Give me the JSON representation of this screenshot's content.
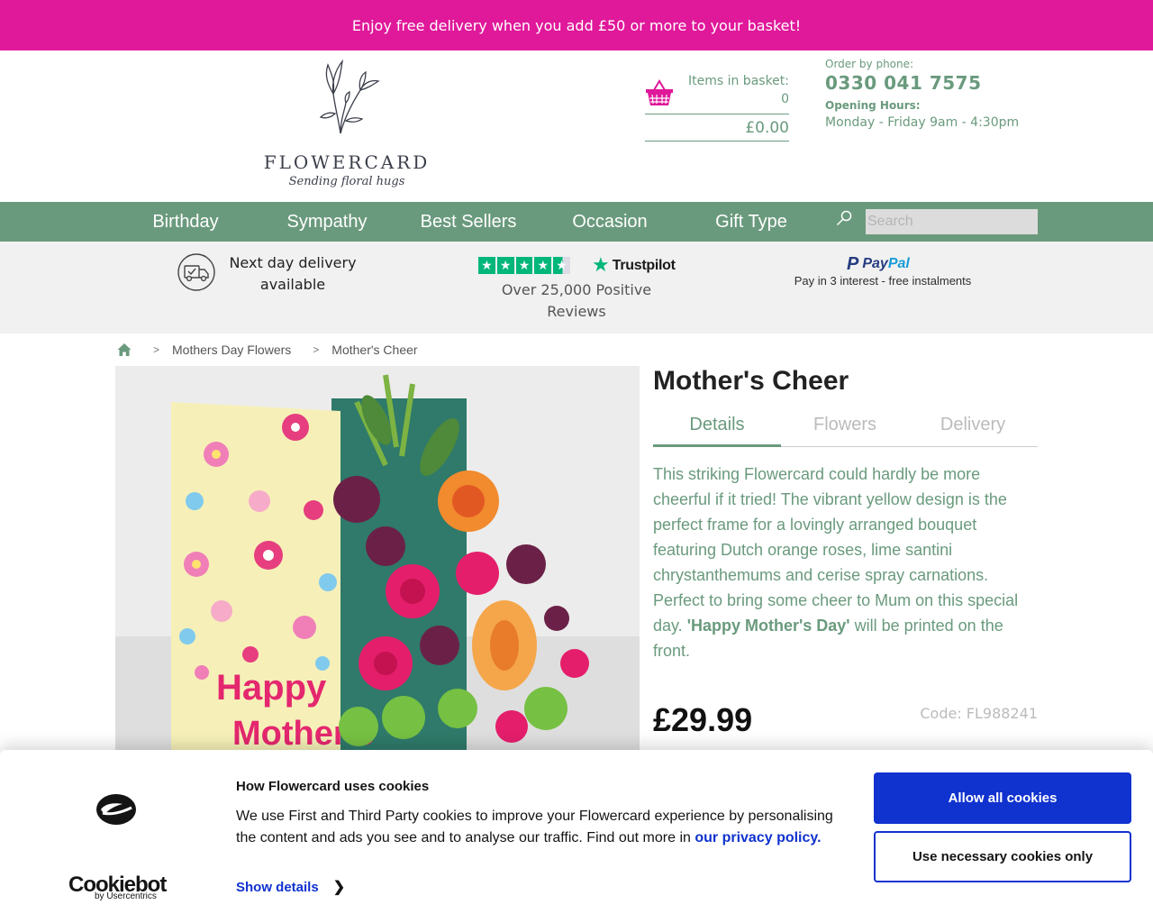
{
  "promo": {
    "text": "Enjoy free delivery when you add £50 or more to your basket!"
  },
  "brand": {
    "name": "FLOWERCARD",
    "tagline": "Sending floral hugs"
  },
  "basket": {
    "label": "Items in basket:",
    "count": "0",
    "total": "£0.00"
  },
  "contact": {
    "order_label": "Order by phone:",
    "phone": "0330 041 7575",
    "hours_label": "Opening Hours:",
    "hours": "Monday - Friday 9am - 4:30pm"
  },
  "nav": {
    "items": [
      "Birthday",
      "Sympathy",
      "Best Sellers",
      "Occasion",
      "Gift Type"
    ],
    "search_placeholder": "Search"
  },
  "usp": {
    "delivery": "Next day delivery available",
    "trustpilot_brand": "Trustpilot",
    "trustpilot_text": "Over 25,000 Positive Reviews",
    "trustpilot_rating": 4.5,
    "paypal_brand_pay": "Pay",
    "paypal_brand_pal": "Pal",
    "paypal_text": "Pay in 3 interest - free instalments"
  },
  "breadcrumb": {
    "items": [
      "Mothers Day Flowers",
      "Mother's Cheer"
    ]
  },
  "product": {
    "title": "Mother's Cheer",
    "tabs": [
      "Details",
      "Flowers",
      "Delivery"
    ],
    "active_tab": "Details",
    "description": "This striking Flowercard could hardly be more cheerful if it tried! The vibrant yellow design is the perfect frame for a lovingly arranged bouquet featuring Dutch orange roses, lime santini chrystanthemums and cerise spray carnations. Perfect to bring some cheer to Mum on this special day.",
    "description_bold": "'Happy Mother's Day'",
    "description_tail": "will be printed on the front.",
    "price": "£29.99",
    "code": "Code: FL988241",
    "card_text_line1": "Happy",
    "card_text_line2": "Mother's"
  },
  "cookies": {
    "brand": "Cookiebot",
    "brand_by": "by Usercentrics",
    "title": "How Flowercard uses cookies",
    "body": "We use First and Third Party cookies to improve your Flowercard experience by personalising the content and ads you see and to analyse our traffic. Find out more in",
    "link": "our privacy policy.",
    "details": "Show details",
    "allow_all": "Allow all cookies",
    "necessary_only": "Use necessary cookies only"
  },
  "colors": {
    "promo_bg": "#e0189a",
    "brand_green": "#6a9a7d",
    "cookie_blue": "#1032cf",
    "trustpilot_green": "#00b67a"
  }
}
